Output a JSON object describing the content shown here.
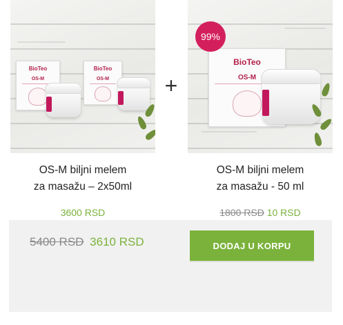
{
  "bundle": {
    "products": [
      {
        "image_alt": "OS-M biljni melem za masažu 2x50ml",
        "brand": "BioTeo",
        "product_mark": "OS-M",
        "title_line1": "OS-M biljni melem",
        "title_line2": "za masažu – 2x50ml",
        "price": "3600 RSD"
      },
      {
        "image_alt": "OS-M biljni melem za masažu 50 ml",
        "brand": "BioTeo",
        "product_mark": "OS-M",
        "badge": "99%",
        "title_line1": "OS-M biljni melem",
        "title_line2": "za masažu - 50 ml",
        "old_price": "1800 RSD",
        "price": "10 RSD"
      }
    ],
    "plus_symbol": "+",
    "summary": {
      "old_total": "5400 RSD",
      "new_total": "3610 RSD",
      "cta_label": "DODAJ U KORPU"
    },
    "colors": {
      "accent_green": "#7ab23b",
      "badge_pink": "#d41f5d",
      "summary_bg": "#f1f1f1"
    }
  }
}
